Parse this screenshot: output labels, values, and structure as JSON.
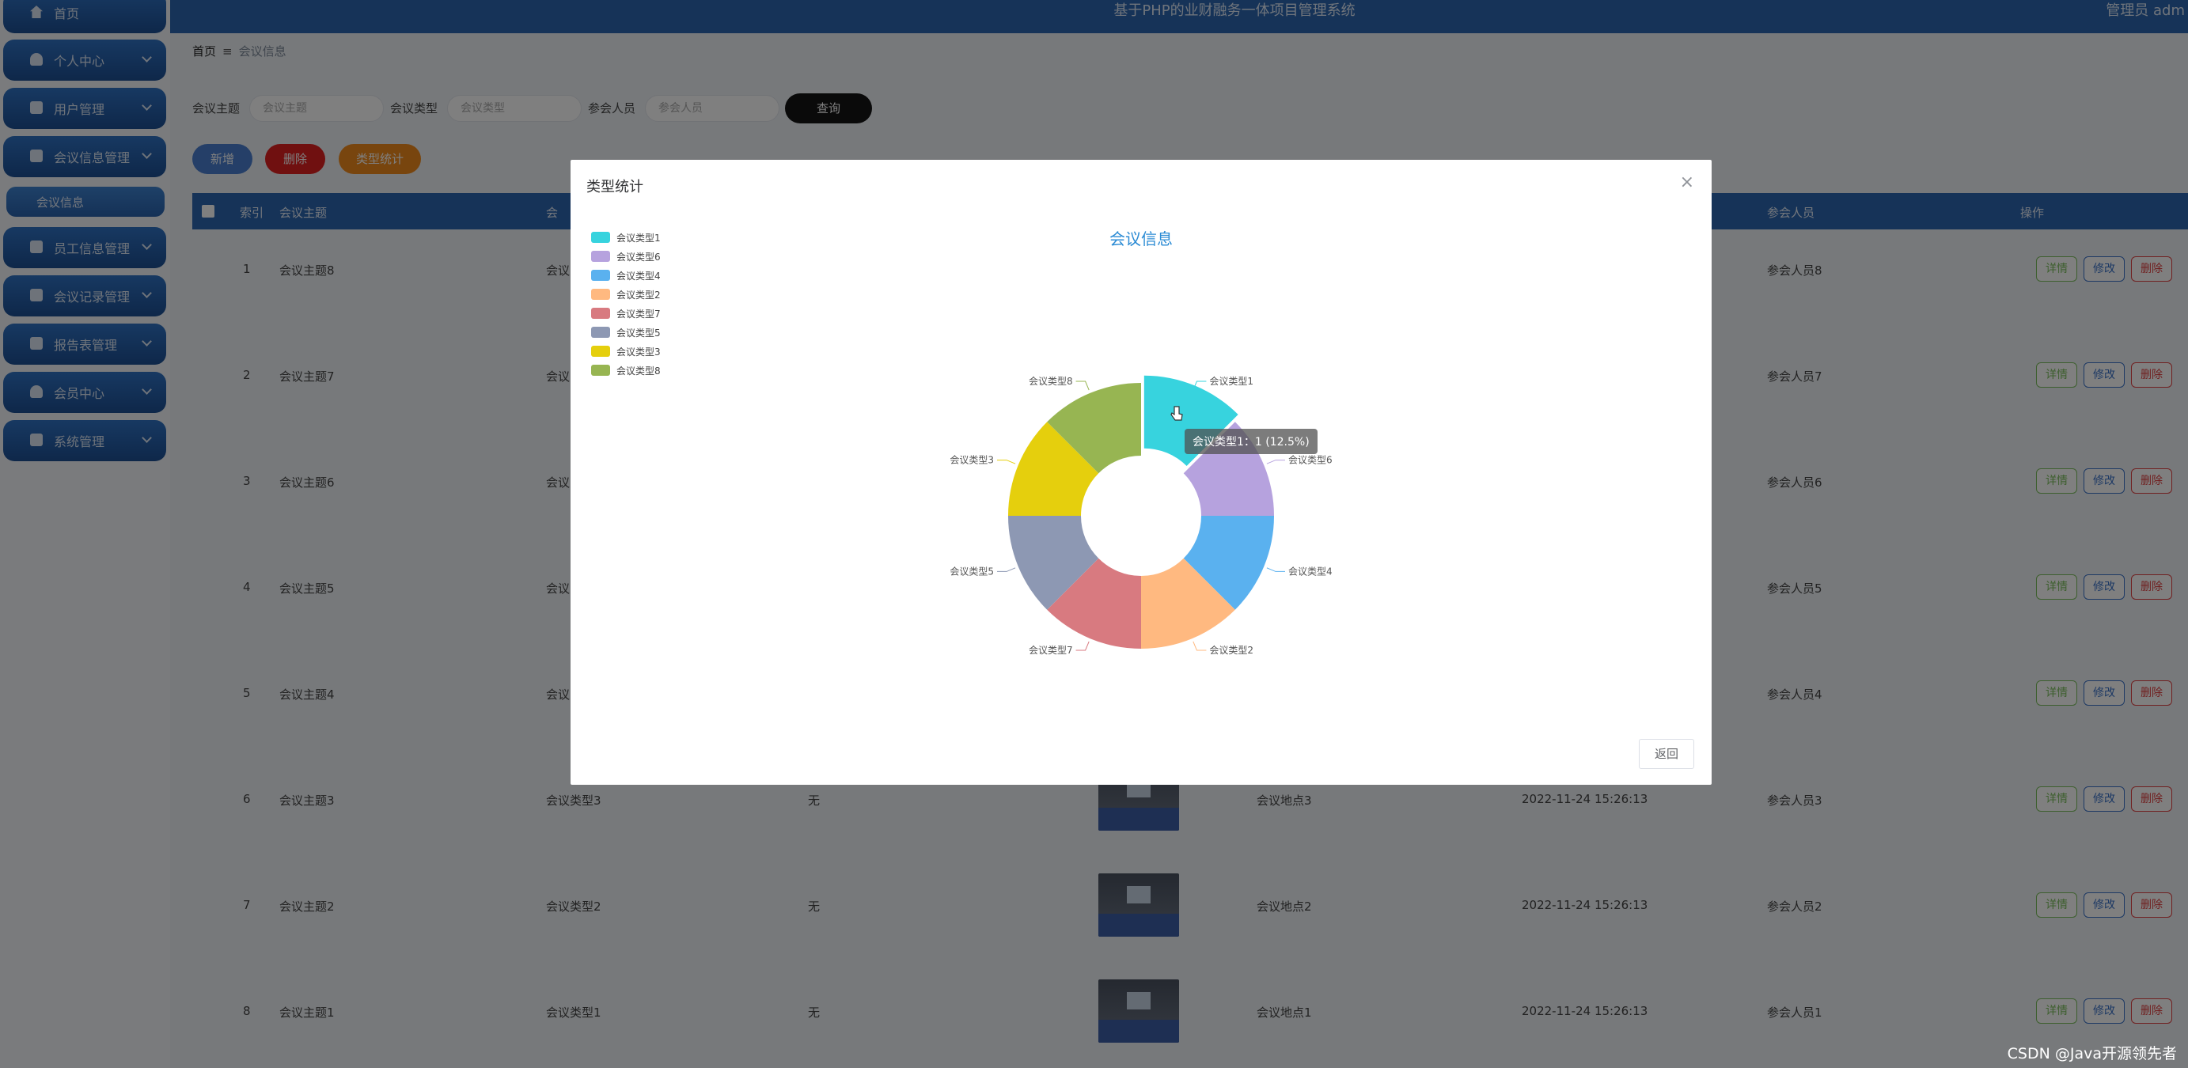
{
  "header": {
    "system_title": "基于PHP的业财融务一体项目管理系统",
    "user": "管理员 adm"
  },
  "sidebar": {
    "items": [
      {
        "label": "首页"
      },
      {
        "label": "个人中心"
      },
      {
        "label": "用户管理"
      },
      {
        "label": "会议信息管理"
      },
      {
        "label": "员工信息管理"
      },
      {
        "label": "会议记录管理"
      },
      {
        "label": "报告表管理"
      },
      {
        "label": "会员中心"
      },
      {
        "label": "系统管理"
      }
    ],
    "sub_item": "会议信息"
  },
  "breadcrumb": {
    "home": "首页",
    "sep": "≡",
    "current": "会议信息"
  },
  "search": {
    "topic_label": "会议主题",
    "topic_placeholder": "会议主题",
    "type_label": "会议类型",
    "type_placeholder": "会议类型",
    "people_label": "参会人员",
    "people_placeholder": "参会人员",
    "query": "查询"
  },
  "actions": {
    "add": "新增",
    "delete": "删除",
    "stats": "类型统计"
  },
  "table": {
    "headers": {
      "index": "索引",
      "topic": "会议主题",
      "type": "会",
      "people": "参会人员",
      "ops": "操作"
    },
    "rows": [
      {
        "index": "1",
        "topic": "会议主题8",
        "type": "会议",
        "remark": "",
        "place": "",
        "time": "",
        "people": "参会人员8"
      },
      {
        "index": "2",
        "topic": "会议主题7",
        "type": "会议",
        "remark": "",
        "place": "",
        "time": "",
        "people": "参会人员7"
      },
      {
        "index": "3",
        "topic": "会议主题6",
        "type": "会议",
        "remark": "",
        "place": "",
        "time": "",
        "people": "参会人员6"
      },
      {
        "index": "4",
        "topic": "会议主题5",
        "type": "会议",
        "remark": "",
        "place": "",
        "time": "",
        "people": "参会人员5"
      },
      {
        "index": "5",
        "topic": "会议主题4",
        "type": "会议",
        "remark": "",
        "place": "",
        "time": "",
        "people": "参会人员4"
      },
      {
        "index": "6",
        "topic": "会议主题3",
        "type": "会议类型3",
        "remark": "无",
        "place": "会议地点3",
        "time": "2022-11-24 15:26:13",
        "people": "参会人员3"
      },
      {
        "index": "7",
        "topic": "会议主题2",
        "type": "会议类型2",
        "remark": "无",
        "place": "会议地点2",
        "time": "2022-11-24 15:26:13",
        "people": "参会人员2"
      },
      {
        "index": "8",
        "topic": "会议主题1",
        "type": "会议类型1",
        "remark": "无",
        "place": "会议地点1",
        "time": "2022-11-24 15:26:13",
        "people": "参会人员1"
      }
    ],
    "op_labels": {
      "detail": "详情",
      "edit": "修改",
      "delete": "删除"
    }
  },
  "dialog": {
    "title": "类型统计",
    "close": "×",
    "back": "返回",
    "tooltip": "会议类型1：1 (12.5%)"
  },
  "chart_data": {
    "type": "pie",
    "title": "会议信息",
    "donut": true,
    "legend_position": "top-left",
    "slices": [
      {
        "name": "会议类型1",
        "value": 1,
        "color": "#37d3de",
        "highlighted": true
      },
      {
        "name": "会议类型6",
        "value": 1,
        "color": "#b6a2de"
      },
      {
        "name": "会议类型4",
        "value": 1,
        "color": "#5ab1ef"
      },
      {
        "name": "会议类型2",
        "value": 1,
        "color": "#ffb980"
      },
      {
        "name": "会议类型7",
        "value": 1,
        "color": "#d87a80"
      },
      {
        "name": "会议类型5",
        "value": 1,
        "color": "#8d98b3"
      },
      {
        "name": "会议类型3",
        "value": 1,
        "color": "#e5cf0d"
      },
      {
        "name": "会议类型8",
        "value": 1,
        "color": "#97b552"
      }
    ]
  },
  "watermark": "CSDN @Java开源领先者"
}
